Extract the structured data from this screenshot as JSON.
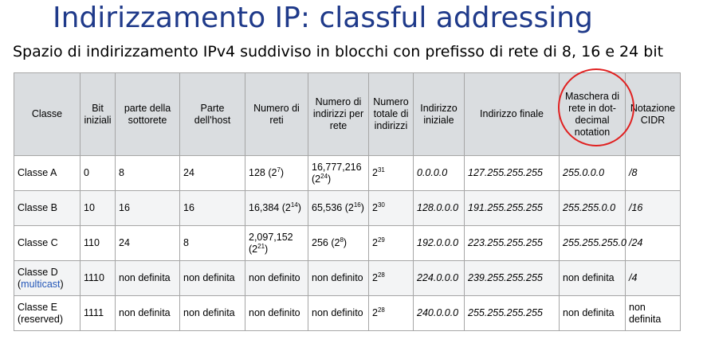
{
  "title": "Indirizzamento IP: classful addressing",
  "subtitle": "Spazio di indirizzamento IPv4 suddiviso in blocchi con prefisso di rete di 8, 16 e 24 bit",
  "table": {
    "headers": [
      "Classe",
      "Bit iniziali",
      "parte della sottorete",
      "Parte dell'host",
      "Numero di reti",
      "Numero di indirizzi per rete",
      "Numero totale di indirizzi",
      "Indirizzo iniziale",
      "Indirizzo finale",
      "Maschera di rete in dot-decimal notation",
      "Notazione CIDR"
    ],
    "rows": [
      {
        "classe": "Classe A",
        "classe_note": "",
        "bit": "0",
        "sottorete": "8",
        "host": "24",
        "reti": "128 (2",
        "reti_exp": "7",
        "reti_close": ")",
        "indirizzi": "16,777,216 (2",
        "indirizzi_exp": "24",
        "indirizzi_close": ")",
        "totale": "2",
        "totale_exp": "31",
        "iniziale": "0.0.0.0",
        "finale": "127.255.255.255",
        "maschera": "255.0.0.0",
        "cidr": "/8"
      },
      {
        "classe": "Classe B",
        "classe_note": "",
        "bit": "10",
        "sottorete": "16",
        "host": "16",
        "reti": "16,384 (2",
        "reti_exp": "14",
        "reti_close": ")",
        "indirizzi": "65,536 (2",
        "indirizzi_exp": "16",
        "indirizzi_close": ")",
        "totale": "2",
        "totale_exp": "30",
        "iniziale": "128.0.0.0",
        "finale": "191.255.255.255",
        "maschera": "255.255.0.0",
        "cidr": "/16"
      },
      {
        "classe": "Classe C",
        "classe_note": "",
        "bit": "110",
        "sottorete": "24",
        "host": "8",
        "reti": "2,097,152 (2",
        "reti_exp": "21",
        "reti_close": ")",
        "indirizzi": "256 (2",
        "indirizzi_exp": "8",
        "indirizzi_close": ")",
        "totale": "2",
        "totale_exp": "29",
        "iniziale": "192.0.0.0",
        "finale": "223.255.255.255",
        "maschera": "255.255.255.0",
        "cidr": "/24"
      },
      {
        "classe": "Classe D",
        "classe_note": "multicast",
        "bit": "1110",
        "sottorete": "non definita",
        "host": "non definita",
        "reti": "non definito",
        "reti_exp": "",
        "reti_close": "",
        "indirizzi": "non definito",
        "indirizzi_exp": "",
        "indirizzi_close": "",
        "totale": "2",
        "totale_exp": "28",
        "iniziale": "224.0.0.0",
        "finale": "239.255.255.255",
        "maschera": "non definita",
        "cidr": "/4"
      },
      {
        "classe": "Classe E",
        "classe_note": "reserved",
        "bit": "1111",
        "sottorete": "non definita",
        "host": "non definita",
        "reti": "non definito",
        "reti_exp": "",
        "reti_close": "",
        "indirizzi": "non definito",
        "indirizzi_exp": "",
        "indirizzi_close": "",
        "totale": "2",
        "totale_exp": "28",
        "iniziale": "240.0.0.0",
        "finale": "255.255.255.255",
        "maschera": "non definita",
        "cidr": "non definita"
      }
    ]
  },
  "colors": {
    "title": "#1f3a8a",
    "header_bg": "#dadde0",
    "highlight_circle": "#e02020",
    "link": "#2457b8"
  }
}
